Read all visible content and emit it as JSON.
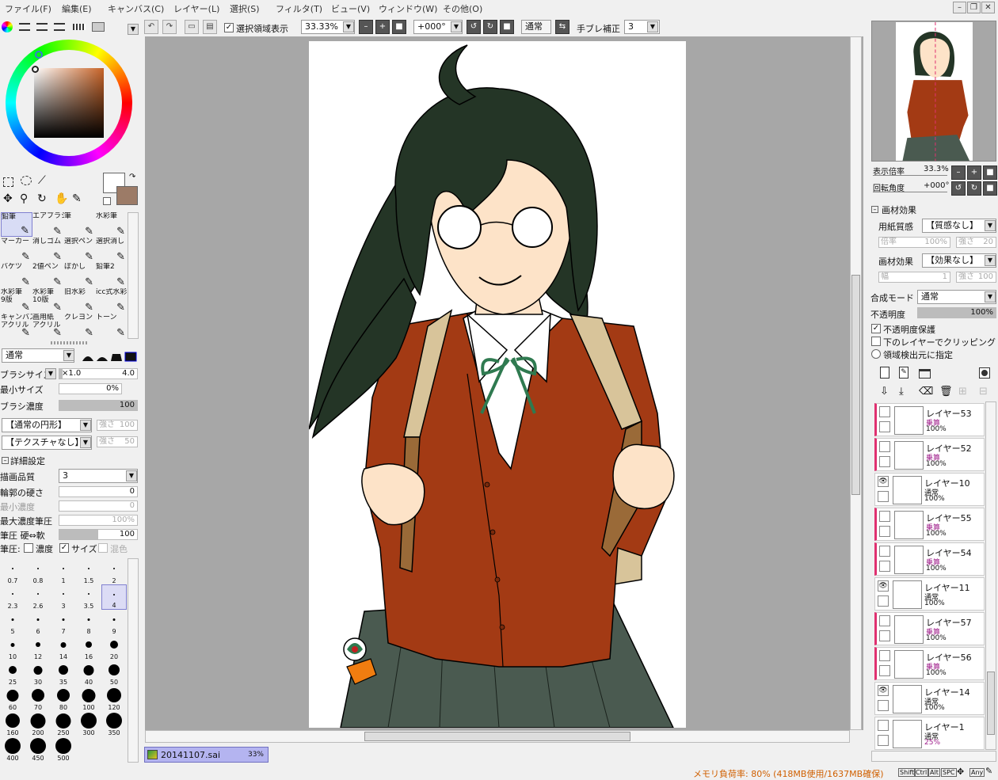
{
  "menu": [
    "ファイル(F)",
    "編集(E)",
    "キャンバス(C)",
    "レイヤー(L)",
    "選択(S)",
    "フィルタ(T)",
    "ビュー(V)",
    "ウィンドウ(W)",
    "その他(O)"
  ],
  "toolbar": {
    "selection_label": "選択領域表示",
    "zoom": "33.33%",
    "rotation": "+000°",
    "blend": "通常",
    "stabilizer_label": "手ブレ補正",
    "stabilizer": "3"
  },
  "tools": [
    {
      "label": "鉛筆",
      "selected": true
    },
    {
      "label": "エアブラシ"
    },
    {
      "label": "筆"
    },
    {
      "label": "水彩筆"
    },
    {
      "label": "マーカー"
    },
    {
      "label": "消しゴム"
    },
    {
      "label": "選択ペン"
    },
    {
      "label": "選択消し"
    },
    {
      "label": "バケツ"
    },
    {
      "label": "2値ペン"
    },
    {
      "label": "ぼかし"
    },
    {
      "label": "鉛筆2"
    },
    {
      "label": "水彩筆\n9版"
    },
    {
      "label": "水彩筆\n10版"
    },
    {
      "label": "旧水彩"
    },
    {
      "label": "icc式水彩"
    },
    {
      "label": "キャンバス\nアクリル"
    },
    {
      "label": "画用紙\nアクリル"
    },
    {
      "label": "クレヨン"
    },
    {
      "label": "トーン"
    }
  ],
  "brush": {
    "mode": "通常",
    "size_label": "ブラシサイズ",
    "size_mult": "×1.0",
    "size": "4.0",
    "min_size_label": "最小サイズ",
    "min_size": "0%",
    "density_label": "ブラシ濃度",
    "density": "100",
    "shape": "【通常の円形】",
    "shape_strength_label": "強さ",
    "shape_strength": "100",
    "texture": "【テクスチャなし】",
    "texture_strength_label": "強さ",
    "texture_strength": "50",
    "detail_label": "詳細設定",
    "quality_label": "描画品質",
    "quality": "3",
    "edge_label": "輪郭の硬さ",
    "edge": "0",
    "min_density_label": "最小濃度",
    "min_density": "0",
    "max_pressure_label": "最大濃度筆圧",
    "max_pressure": "100%",
    "pressure_label": "筆圧 硬⇔軟",
    "pressure": "100",
    "pressure_row_label": "筆圧:",
    "p_density": "濃度",
    "p_size": "サイズ",
    "p_blend": "混色"
  },
  "brush_sizes": [
    "0.7",
    "0.8",
    "1",
    "1.5",
    "2",
    "2.3",
    "2.6",
    "3",
    "3.5",
    "4",
    "5",
    "6",
    "7",
    "8",
    "9",
    "10",
    "12",
    "14",
    "16",
    "20",
    "25",
    "30",
    "35",
    "40",
    "50",
    "60",
    "70",
    "80",
    "100",
    "120",
    "160",
    "200",
    "250",
    "300",
    "350",
    "400",
    "450",
    "500"
  ],
  "brush_dot_fraction": [
    0.04,
    0.04,
    0.05,
    0.06,
    0.07,
    0.08,
    0.08,
    0.09,
    0.1,
    0.11,
    0.13,
    0.14,
    0.15,
    0.16,
    0.17,
    0.25,
    0.3,
    0.35,
    0.4,
    0.5,
    0.52,
    0.56,
    0.6,
    0.64,
    0.7,
    0.74,
    0.78,
    0.82,
    0.86,
    0.9,
    0.92,
    0.94,
    0.96,
    0.98,
    1,
    1,
    1,
    1
  ],
  "file_tab": {
    "name": "20141107.sai",
    "zoom": "33%"
  },
  "navigator": {
    "zoom_label": "表示倍率",
    "zoom": "33.3%",
    "rot_label": "回転角度",
    "rot": "+000°"
  },
  "material": {
    "title": "画材効果",
    "paper_label": "用紙質感",
    "paper": "【質感なし】",
    "paper_scale_label": "倍率",
    "paper_scale": "100%",
    "paper_strength_label": "強さ",
    "paper_strength": "20",
    "effect_label": "画材効果",
    "effect": "【効果なし】",
    "width_label": "幅",
    "width": "1",
    "effect_strength_label": "強さ",
    "effect_strength": "100"
  },
  "layer_props": {
    "blend_label": "合成モード",
    "blend": "通常",
    "opacity_label": "不透明度",
    "opacity": "100%",
    "protect": "不透明度保護",
    "clip": "下のレイヤーでクリッピング",
    "source": "領域検出元に指定"
  },
  "layers": [
    {
      "name": "レイヤー53",
      "mode": "乗算",
      "opacity": "100%",
      "visible": false,
      "red": true
    },
    {
      "name": "レイヤー52",
      "mode": "乗算",
      "opacity": "100%",
      "visible": false,
      "red": true
    },
    {
      "name": "レイヤー10",
      "mode": "通常",
      "opacity": "100%",
      "visible": true,
      "red": false
    },
    {
      "name": "レイヤー55",
      "mode": "乗算",
      "opacity": "100%",
      "visible": false,
      "red": true
    },
    {
      "name": "レイヤー54",
      "mode": "乗算",
      "opacity": "100%",
      "visible": false,
      "red": true
    },
    {
      "name": "レイヤー11",
      "mode": "通常",
      "opacity": "100%",
      "visible": true,
      "red": false
    },
    {
      "name": "レイヤー57",
      "mode": "乗算",
      "opacity": "100%",
      "visible": false,
      "red": true
    },
    {
      "name": "レイヤー56",
      "mode": "乗算",
      "opacity": "100%",
      "visible": false,
      "red": true
    },
    {
      "name": "レイヤー14",
      "mode": "通常",
      "opacity": "100%",
      "visible": true,
      "red": false
    },
    {
      "name": "レイヤー1",
      "mode": "通常",
      "opacity": "25%",
      "visible": false,
      "red": false
    }
  ],
  "status": {
    "memory": "メモリ負荷率: 80% (418MB使用/1637MB確保)",
    "keys": [
      "Shift",
      "Ctrl",
      "Alt",
      "SPC",
      "Any"
    ]
  },
  "colors": {
    "accent": "#e03070",
    "sweater": "#a33a14",
    "hair": "#243526",
    "skirt": "#4a5a50",
    "strap": "#9a6a38",
    "bag": "#d8c49a",
    "skin": "#fde3c8",
    "ribbon": "#2f7a50",
    "fg_color": "#ffffff",
    "bg_color": "#9c7b67",
    "mode_highlight": "#0000d0",
    "layer_clip_mode": "#a0208c"
  }
}
